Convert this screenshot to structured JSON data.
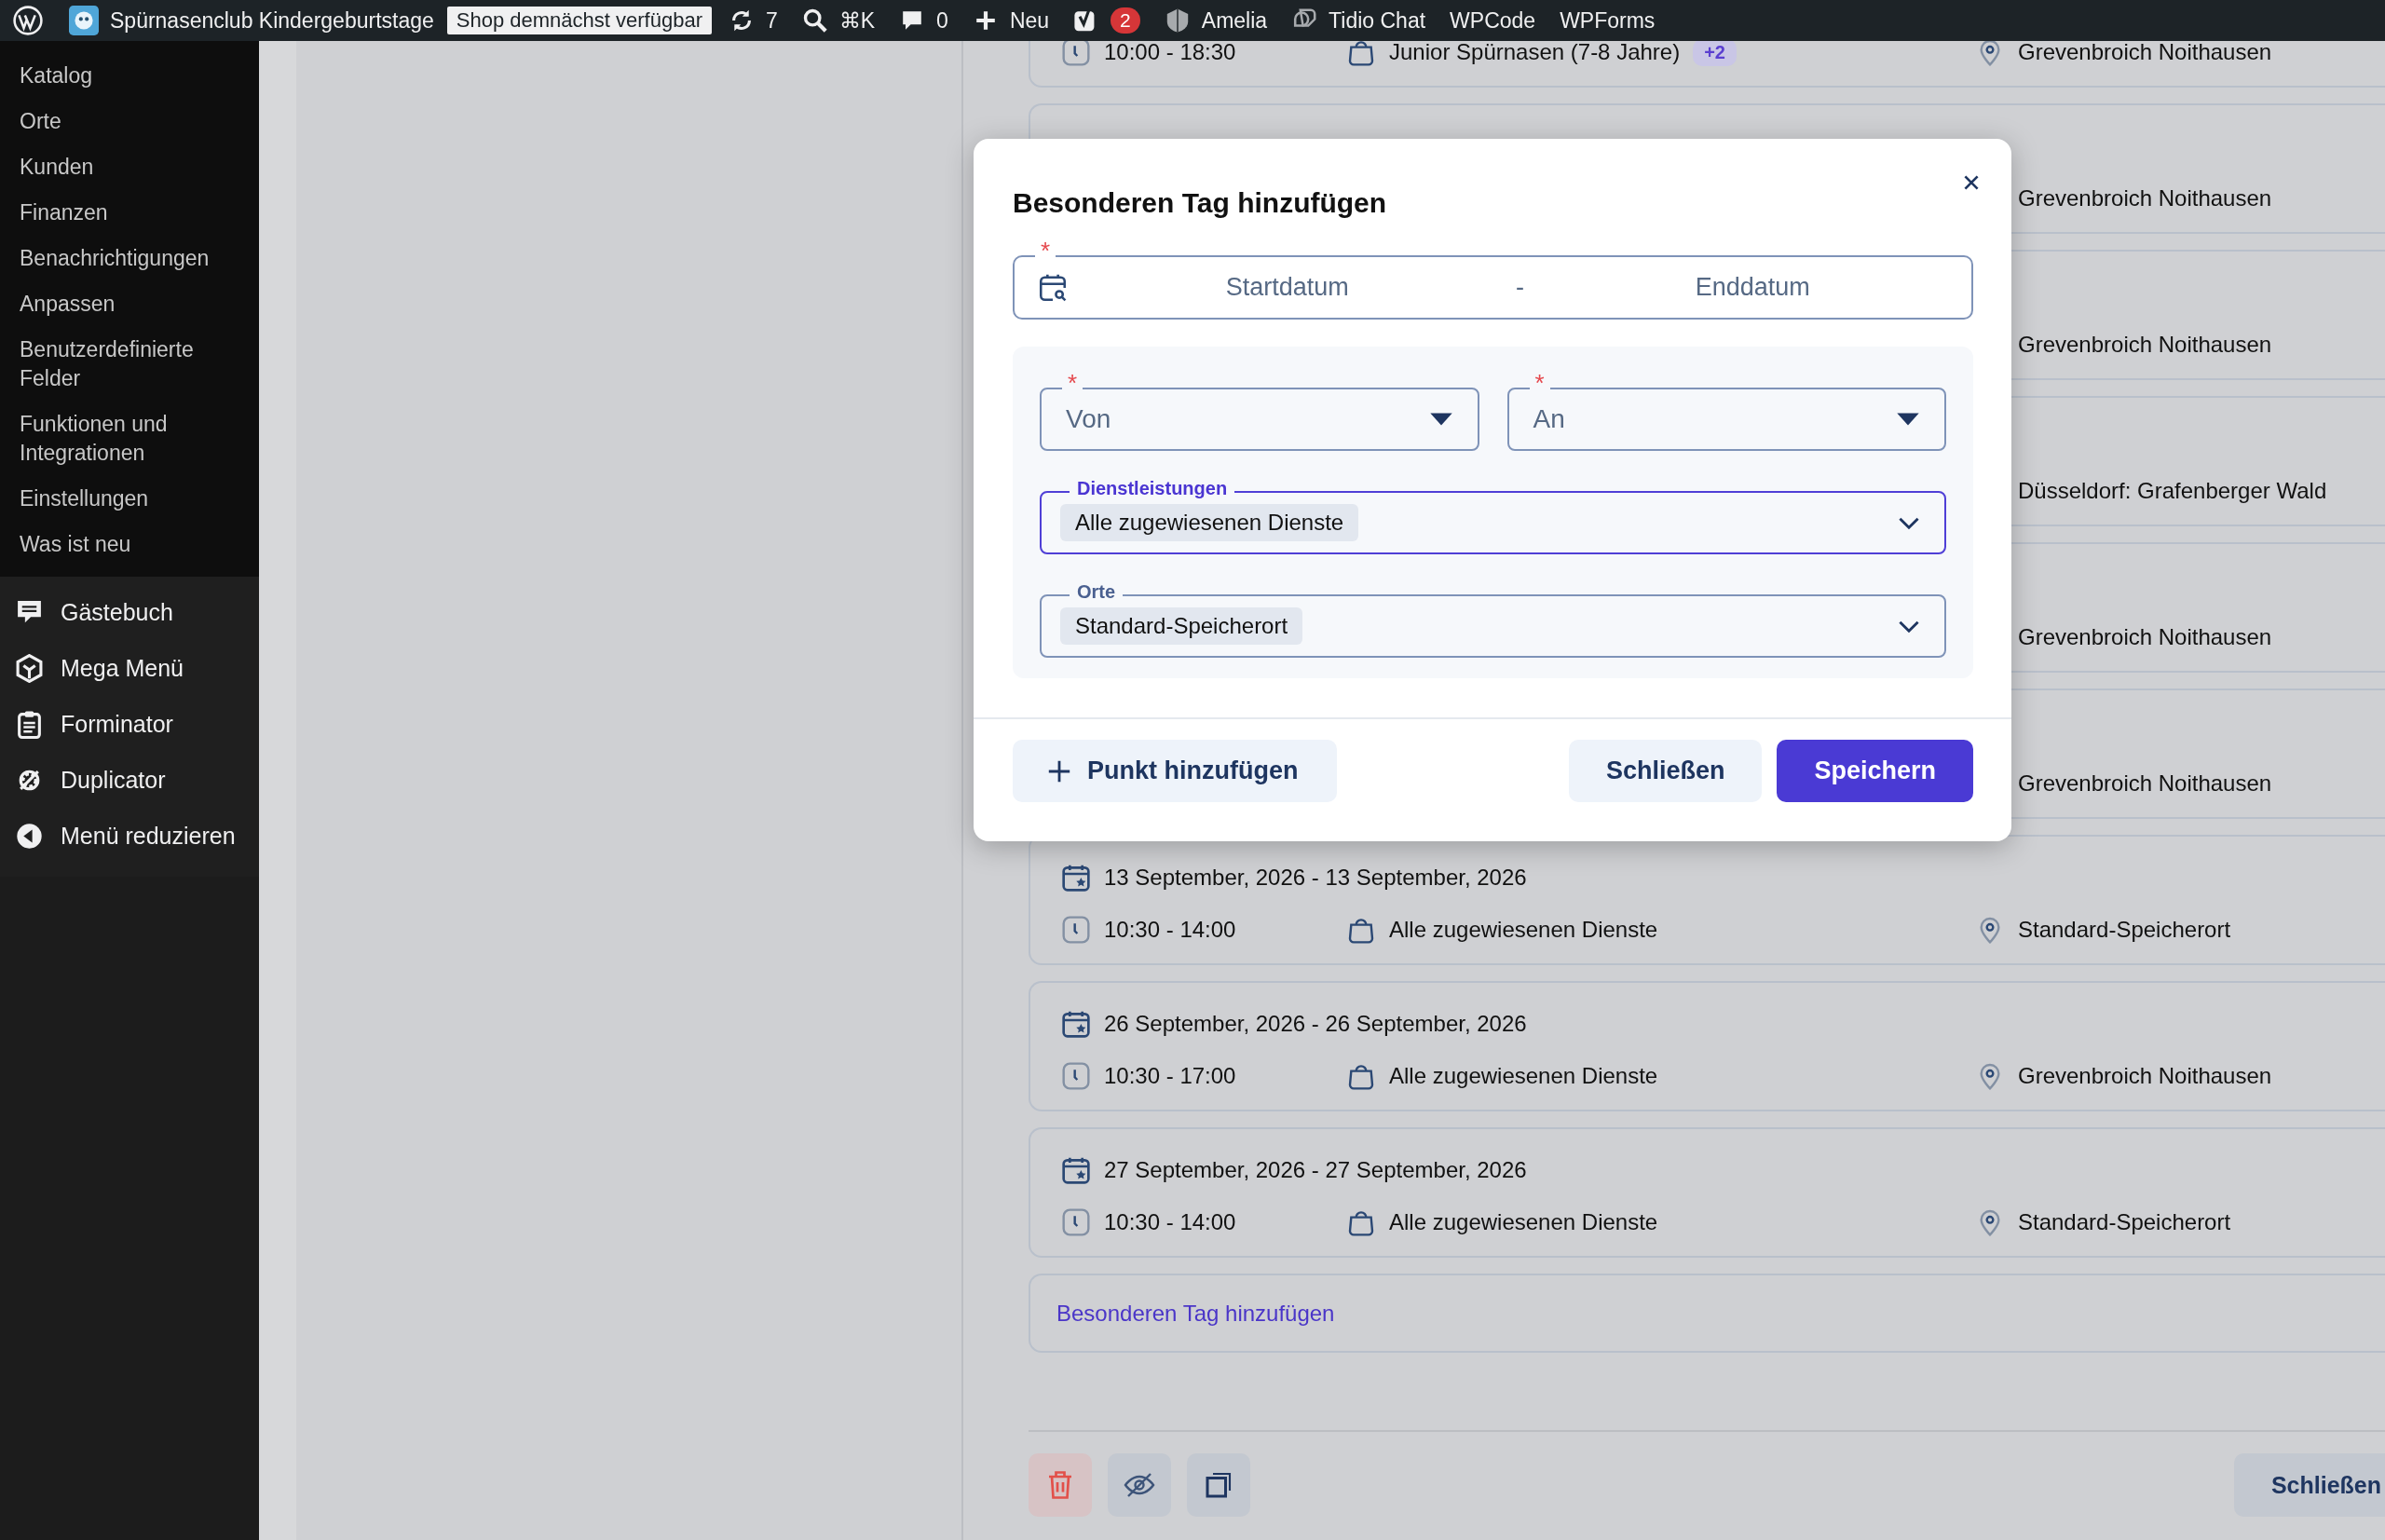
{
  "admin_bar": {
    "site_title": "Spürnasenclub Kindergeburtstage",
    "site_badge": "Shop demnächst verfügbar",
    "updates": "7",
    "search_shortcut": "⌘K",
    "comments": "0",
    "new": "Neu",
    "yoast_count": "2",
    "items": [
      {
        "label": "Amelia"
      },
      {
        "label": "Tidio Chat"
      },
      {
        "label": "WPCode"
      },
      {
        "label": "WPForms"
      }
    ]
  },
  "sidebar": {
    "submenu": [
      "Katalog",
      "Orte",
      "Kunden",
      "Finanzen",
      "Benachrichtigungen",
      "Anpassen",
      "Benutzerdefinierte Felder",
      "Funktionen und Integrationen",
      "Einstellungen",
      "Was ist neu"
    ],
    "menu": [
      "Gästebuch",
      "Mega Menü",
      "Forminator",
      "Duplicator",
      "Menü reduzieren"
    ]
  },
  "special_days": [
    {
      "kind": "time-only",
      "time": "10:00 - 18:30",
      "service": "Junior Spürnasen (7-8 Jahre)",
      "service_extra": "+2",
      "location": "Grevenbroich Noithausen"
    },
    {
      "kind": "covered",
      "location": "Grevenbroich Noithausen"
    },
    {
      "kind": "covered",
      "location": "Grevenbroich Noithausen"
    },
    {
      "kind": "covered",
      "location": "Düsseldorf: Grafenberger Wald"
    },
    {
      "kind": "covered",
      "location": "Grevenbroich Noithausen"
    },
    {
      "kind": "covered",
      "location": "Grevenbroich Noithausen"
    },
    {
      "kind": "full",
      "date": "13 September, 2026 - 13 September, 2026",
      "time": "10:30 - 14:00",
      "service": "Alle zugewiesenen Dienste",
      "location": "Standard-Speicherort"
    },
    {
      "kind": "full",
      "date": "26 September, 2026 - 26 September, 2026",
      "time": "10:30 - 17:00",
      "service": "Alle zugewiesenen Dienste",
      "location": "Grevenbroich Noithausen"
    },
    {
      "kind": "full",
      "date": "27 September, 2026 - 27 September, 2026",
      "time": "10:30 - 14:00",
      "service": "Alle zugewiesenen Dienste",
      "location": "Standard-Speicherort"
    }
  ],
  "add_link": "Besonderen Tag hinzufügen",
  "footer": {
    "close": "Schließen"
  },
  "modal": {
    "title": "Besonderen Tag hinzufügen",
    "date_range": {
      "required_mark": "*",
      "start_placeholder": "Startdatum",
      "separator": "-",
      "end_placeholder": "Enddatum"
    },
    "from": {
      "placeholder": "Von",
      "required_mark": "*"
    },
    "to": {
      "placeholder": "An",
      "required_mark": "*"
    },
    "services": {
      "label": "Dienstleistungen",
      "value": "Alle zugewiesenen Dienste",
      "focused": true
    },
    "locations": {
      "label": "Orte",
      "value": "Standard-Speicherort",
      "focused": false
    },
    "add_button": "Punkt hinzufügen",
    "close_button": "Schließen",
    "save_button": "Speichern"
  }
}
